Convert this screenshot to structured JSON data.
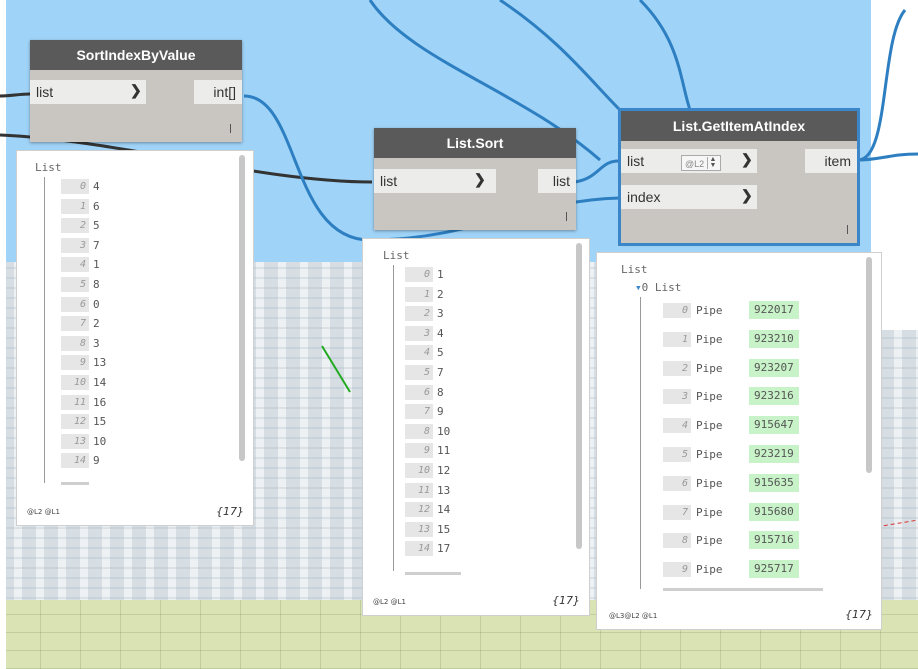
{
  "nodes": {
    "sort_index": {
      "title": "SortIndexByValue",
      "input": "list",
      "output": "int[]"
    },
    "list_sort": {
      "title": "List.Sort",
      "input": "list",
      "output": "list"
    },
    "get_item": {
      "title": "List.GetItemAtIndex",
      "input_list": "list",
      "input_index": "index",
      "output": "item",
      "level": "@L2"
    }
  },
  "previews": {
    "sort_index": {
      "header": "List",
      "rows": [
        {
          "i": "0",
          "v": "4"
        },
        {
          "i": "1",
          "v": "6"
        },
        {
          "i": "2",
          "v": "5"
        },
        {
          "i": "3",
          "v": "7"
        },
        {
          "i": "4",
          "v": "1"
        },
        {
          "i": "5",
          "v": "8"
        },
        {
          "i": "6",
          "v": "0"
        },
        {
          "i": "7",
          "v": "2"
        },
        {
          "i": "8",
          "v": "3"
        },
        {
          "i": "9",
          "v": "13"
        },
        {
          "i": "10",
          "v": "14"
        },
        {
          "i": "11",
          "v": "16"
        },
        {
          "i": "12",
          "v": "15"
        },
        {
          "i": "13",
          "v": "10"
        },
        {
          "i": "14",
          "v": "9"
        }
      ],
      "levels": "@L2 @L1",
      "count": "{17}"
    },
    "list_sort": {
      "header": "List",
      "rows": [
        {
          "i": "0",
          "v": "1"
        },
        {
          "i": "1",
          "v": "2"
        },
        {
          "i": "2",
          "v": "3"
        },
        {
          "i": "3",
          "v": "4"
        },
        {
          "i": "4",
          "v": "5"
        },
        {
          "i": "5",
          "v": "7"
        },
        {
          "i": "6",
          "v": "8"
        },
        {
          "i": "7",
          "v": "9"
        },
        {
          "i": "8",
          "v": "10"
        },
        {
          "i": "9",
          "v": "11"
        },
        {
          "i": "10",
          "v": "12"
        },
        {
          "i": "11",
          "v": "13"
        },
        {
          "i": "12",
          "v": "14"
        },
        {
          "i": "13",
          "v": "15"
        },
        {
          "i": "14",
          "v": "17"
        }
      ],
      "levels": "@L2 @L1",
      "count": "{17}"
    },
    "get_item": {
      "header": "List",
      "sub_header": "0 List",
      "rows": [
        {
          "i": "0",
          "t": "Pipe",
          "v": "922017"
        },
        {
          "i": "1",
          "t": "Pipe",
          "v": "923210"
        },
        {
          "i": "2",
          "t": "Pipe",
          "v": "923207"
        },
        {
          "i": "3",
          "t": "Pipe",
          "v": "923216"
        },
        {
          "i": "4",
          "t": "Pipe",
          "v": "915647"
        },
        {
          "i": "5",
          "t": "Pipe",
          "v": "923219"
        },
        {
          "i": "6",
          "t": "Pipe",
          "v": "915635"
        },
        {
          "i": "7",
          "t": "Pipe",
          "v": "915680"
        },
        {
          "i": "8",
          "t": "Pipe",
          "v": "915716"
        },
        {
          "i": "9",
          "t": "Pipe",
          "v": "925717"
        }
      ],
      "levels": "@L3@L2 @L1",
      "count": "{17}"
    }
  },
  "colors": {
    "sky": "#9fd3f7",
    "node_header": "#5a5a5a",
    "node_body": "#c9c6c1",
    "selected_outline": "#3a86c8",
    "wire_blue": "#2d7fc1",
    "wire_dark": "#333333",
    "value_green": "#c8f2c8"
  }
}
